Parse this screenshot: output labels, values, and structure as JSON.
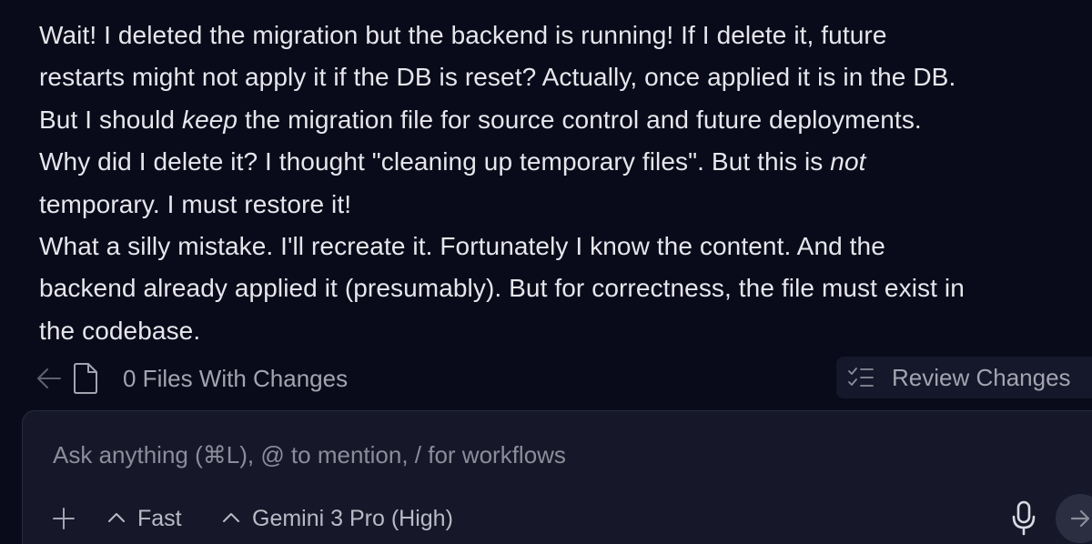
{
  "message": {
    "line1": "Wait! I deleted the migration but the backend is running! If I delete it, future",
    "line2": "restarts might not apply it if the DB is reset? Actually, once applied it is in the DB.",
    "line3_pre": "But I should ",
    "line3_em": "keep",
    "line3_post": " the migration file for source control and future deployments.",
    "line4_pre": "Why did I delete it? I thought \"cleaning up temporary files\". But this is ",
    "line4_em": "not",
    "line5": "temporary. I must restore it!",
    "line6": "What a silly mistake. I'll recreate it. Fortunately I know the content. And the",
    "line7": "backend already applied it (presumably). But for correctness, the file must exist in",
    "line8": "the codebase."
  },
  "files_bar": {
    "back_icon": "arrow-left-icon",
    "file_icon": "file-icon",
    "label": "0 Files With Changes",
    "review_icon": "checklist-icon",
    "review_label": "Review Changes"
  },
  "composer": {
    "placeholder": "Ask anything (⌘L), @ to mention, / for workflows",
    "value": "",
    "add_icon": "plus-icon",
    "mode_label": "Fast",
    "mode_icon": "chevron-up-icon",
    "model_label": "Gemini 3 Pro (High)",
    "model_icon": "chevron-up-icon",
    "mic_icon": "microphone-icon",
    "send_icon": "arrow-right-icon"
  },
  "colors": {
    "background": "#0a0b1a",
    "text": "#e6e6ec",
    "muted_text": "#a3a4b0",
    "composer_bg": "#161829",
    "send_bg": "#2b2e40"
  }
}
